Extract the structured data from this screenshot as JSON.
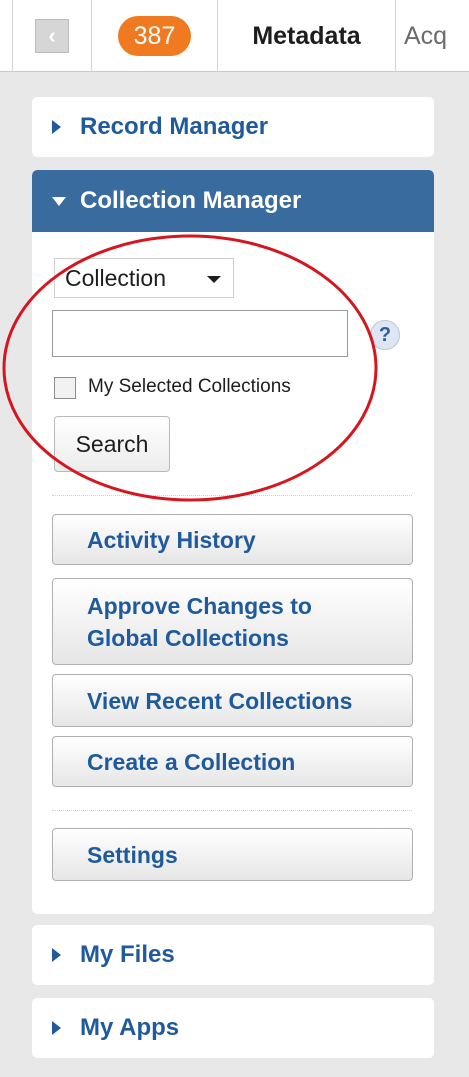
{
  "tabs": {
    "back_glyph": "‹",
    "count": "387",
    "active_label": "Metadata",
    "next_label_partial": "Acq"
  },
  "panels": {
    "record_manager": {
      "label": "Record Manager"
    },
    "collection_manager": {
      "label": "Collection Manager",
      "search_type": {
        "selected": "Collection"
      },
      "search_input": {
        "value": "",
        "placeholder": ""
      },
      "help_glyph": "?",
      "my_selected_checkbox": {
        "label": "My Selected Collections",
        "checked": false
      },
      "search_button": "Search",
      "actions": [
        {
          "id": "activity-history",
          "label": "Activity History"
        },
        {
          "id": "approve-changes",
          "label_line1": "Approve Changes to",
          "label_line2": "Global Collections"
        },
        {
          "id": "view-recent",
          "label": "View Recent Collections"
        },
        {
          "id": "create-collection",
          "label": "Create a Collection"
        }
      ],
      "settings_button": "Settings"
    },
    "my_files": {
      "label": "My Files"
    },
    "my_apps": {
      "label": "My Apps"
    }
  },
  "colors": {
    "accent_blue": "#1f5a9c",
    "header_blue": "#3a6b9e",
    "badge_orange": "#f07a20",
    "annotation_red": "#d6161e"
  }
}
